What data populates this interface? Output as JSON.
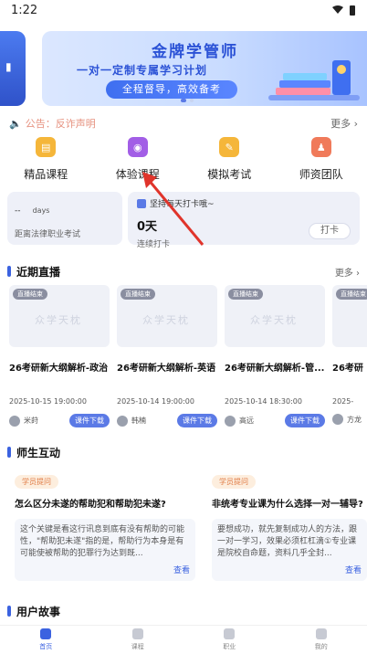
{
  "status_bar": {
    "time": "1:22"
  },
  "banner": {
    "title": "金牌学管师",
    "subtitle": "一对一定制专属学习计划",
    "pill": "全程督导，高效备考"
  },
  "notice": {
    "text": "公告：反诈声明",
    "more": "更多 ›"
  },
  "quick_actions": [
    {
      "label": "精品课程",
      "icon": "course-icon",
      "color": "#f5b63a"
    },
    {
      "label": "体验课程",
      "icon": "trial-course-icon",
      "color": "#a25ee6"
    },
    {
      "label": "模拟考试",
      "icon": "mock-exam-icon",
      "color": "#f5b63a"
    },
    {
      "label": "师资团队",
      "icon": "teacher-team-icon",
      "color": "#f07a5a"
    }
  ],
  "countdown_card": {
    "dash": "--",
    "days_label": "days",
    "exam": "距离法律职业考试"
  },
  "checkin_card": {
    "header": "坚持每天打卡哦~",
    "days": "0天",
    "streak": "连续打卡",
    "button": "打卡"
  },
  "live": {
    "title": "近期直播",
    "more": "更多 ›",
    "cards": [
      {
        "badge": "直播结束",
        "watermark": "众学天枕",
        "title": "26考研新大纲解析-政治",
        "time": "2025-10-15 19:00:00",
        "teacher": "米莳",
        "button": "课件下载"
      },
      {
        "badge": "直播结束",
        "watermark": "众学天枕",
        "title": "26考研新大纲解析-英语",
        "time": "2025-10-14 19:00:00",
        "teacher": "韩楠",
        "button": "课件下载"
      },
      {
        "badge": "直播结束",
        "watermark": "众学天枕",
        "title": "26考研新大纲解析-管...",
        "time": "2025-10-14 18:30:00",
        "teacher": "高远",
        "button": "课件下载"
      },
      {
        "badge": "直播结束",
        "watermark": "众学天枕",
        "title": "26考研",
        "time": "2025-",
        "teacher": "方龙",
        "button": ""
      }
    ]
  },
  "interaction": {
    "title": "师生互动",
    "cards": [
      {
        "tag": "学员提问",
        "question": "怎么区分未遂的帮助犯和帮助犯未遂?",
        "answer": "这个关键是看这行讯息到底有没有帮助的可能性，\"帮助犯未遂\"指的是，帮助行为本身是有可能使被帮助的犯罪行为达到既...",
        "view": "查看"
      },
      {
        "tag": "学员提问",
        "question": "非统考专业课为什么选择一对一辅导?",
        "answer": "要想成功，就先复制成功人的方法，跟一对一学习，效果必须杠杠滴①专业课是院校自命题，资料几乎全封...",
        "view": "查看"
      }
    ]
  },
  "stories": {
    "title": "用户故事"
  },
  "bottom_nav": [
    {
      "label": "首页",
      "active": true
    },
    {
      "label": "课程",
      "active": false
    },
    {
      "label": "职业",
      "active": false
    },
    {
      "label": "我的",
      "active": false
    }
  ]
}
